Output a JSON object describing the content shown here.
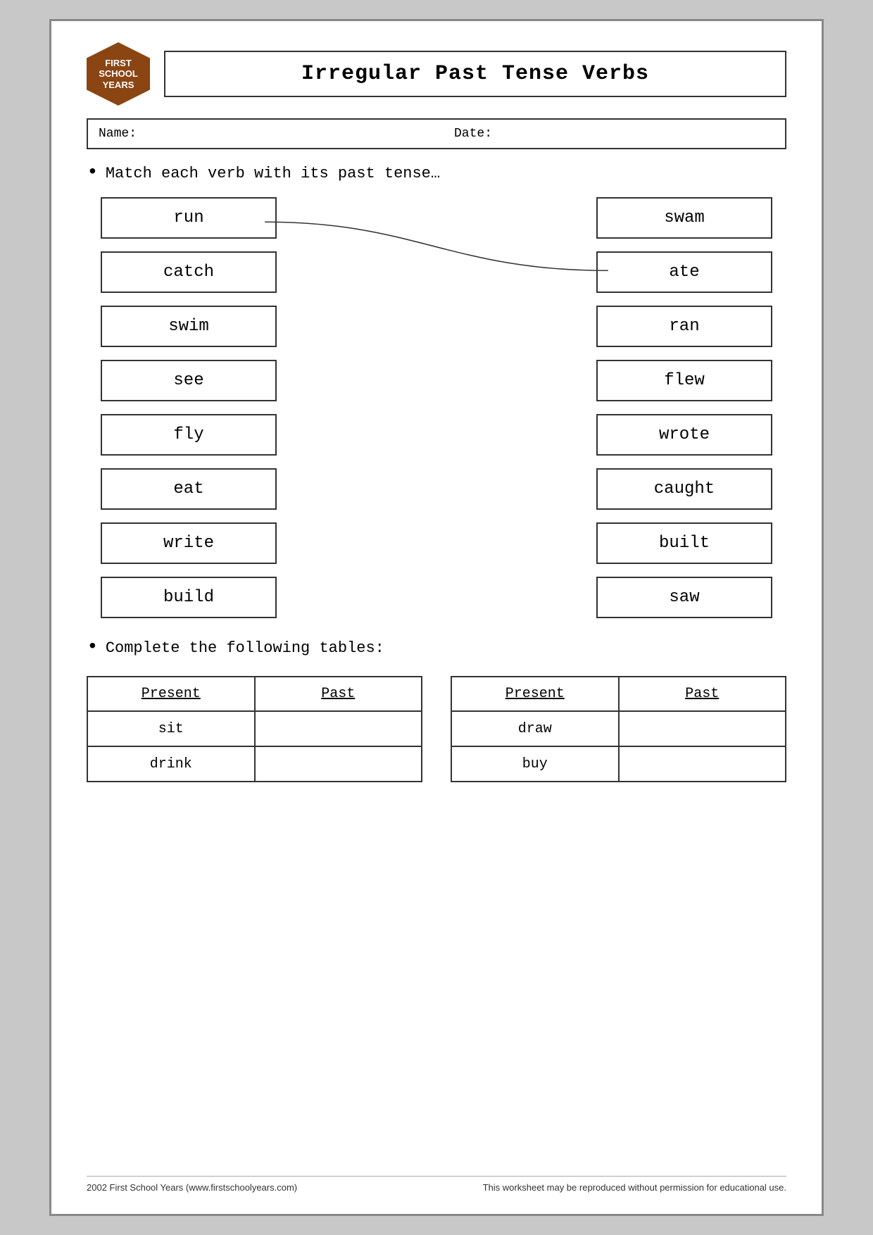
{
  "header": {
    "logo": {
      "line1": "FIRST",
      "line2": "SCHOOL",
      "line3": "YEARS"
    },
    "title": "Irregular Past Tense Verbs"
  },
  "fields": {
    "name_label": "Name:",
    "date_label": "Date:"
  },
  "instruction1": "Match each verb with its past tense…",
  "left_words": [
    "run",
    "catch",
    "swim",
    "see",
    "fly",
    "eat",
    "write",
    "build"
  ],
  "right_words": [
    "swam",
    "ate",
    "ran",
    "flew",
    "wrote",
    "caught",
    "built",
    "saw"
  ],
  "instruction2": "Complete the following tables:",
  "table1": {
    "headers": [
      "Present",
      "Past"
    ],
    "rows": [
      [
        "sit",
        ""
      ],
      [
        "drink",
        ""
      ]
    ]
  },
  "table2": {
    "headers": [
      "Present",
      "Past"
    ],
    "rows": [
      [
        "draw",
        ""
      ],
      [
        "buy",
        ""
      ]
    ]
  },
  "footer": {
    "left": "2002 First School Years  (www.firstschoolyears.com)",
    "right": "This worksheet may be reproduced without permission for educational use."
  }
}
